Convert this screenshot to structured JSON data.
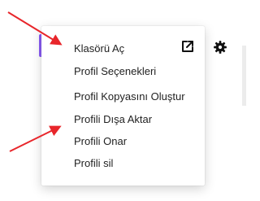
{
  "menu": {
    "items": [
      {
        "label": "Klasörü Aç"
      },
      {
        "label": "Profil Seçenekleri"
      },
      {
        "label": "Profil Kopyasını Oluştur"
      },
      {
        "label": "Profili Dışa Aktar"
      },
      {
        "label": "Profili Onar"
      },
      {
        "label": "Profili sil"
      }
    ],
    "open_external_icon": "open-external-icon"
  },
  "toolbar": {
    "settings_icon": "gear-icon"
  },
  "annotations": {
    "arrow_color": "#e8262b"
  },
  "colors": {
    "accent": "#8a5cf6",
    "menu_text": "#222222",
    "menu_bg": "#ffffff"
  }
}
